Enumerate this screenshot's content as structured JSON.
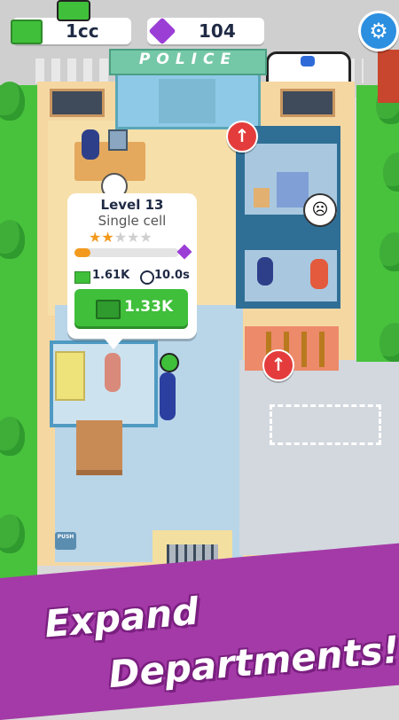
{
  "hud": {
    "cash_value": "1cc",
    "gems_value": "104",
    "settings_icon": "gear-icon"
  },
  "building": {
    "sign": "POLICE"
  },
  "cell_popup": {
    "level": "Level 13",
    "name": "Single cell",
    "stars_filled": 2,
    "stars_total": 5,
    "progress_fraction": 0.15,
    "income": "1.61K",
    "time": "10.0s",
    "upgrade_cost": "1.33K"
  },
  "floor_labels": {
    "push_sign": "PUSH"
  },
  "promo": {
    "line1": "Expand",
    "line2": "Departments!"
  },
  "colors": {
    "accent_green": "#3fbf3a",
    "banner_purple": "#a43aa7",
    "upgrade_red": "#e43c3c",
    "progress_orange": "#f39a1e"
  }
}
